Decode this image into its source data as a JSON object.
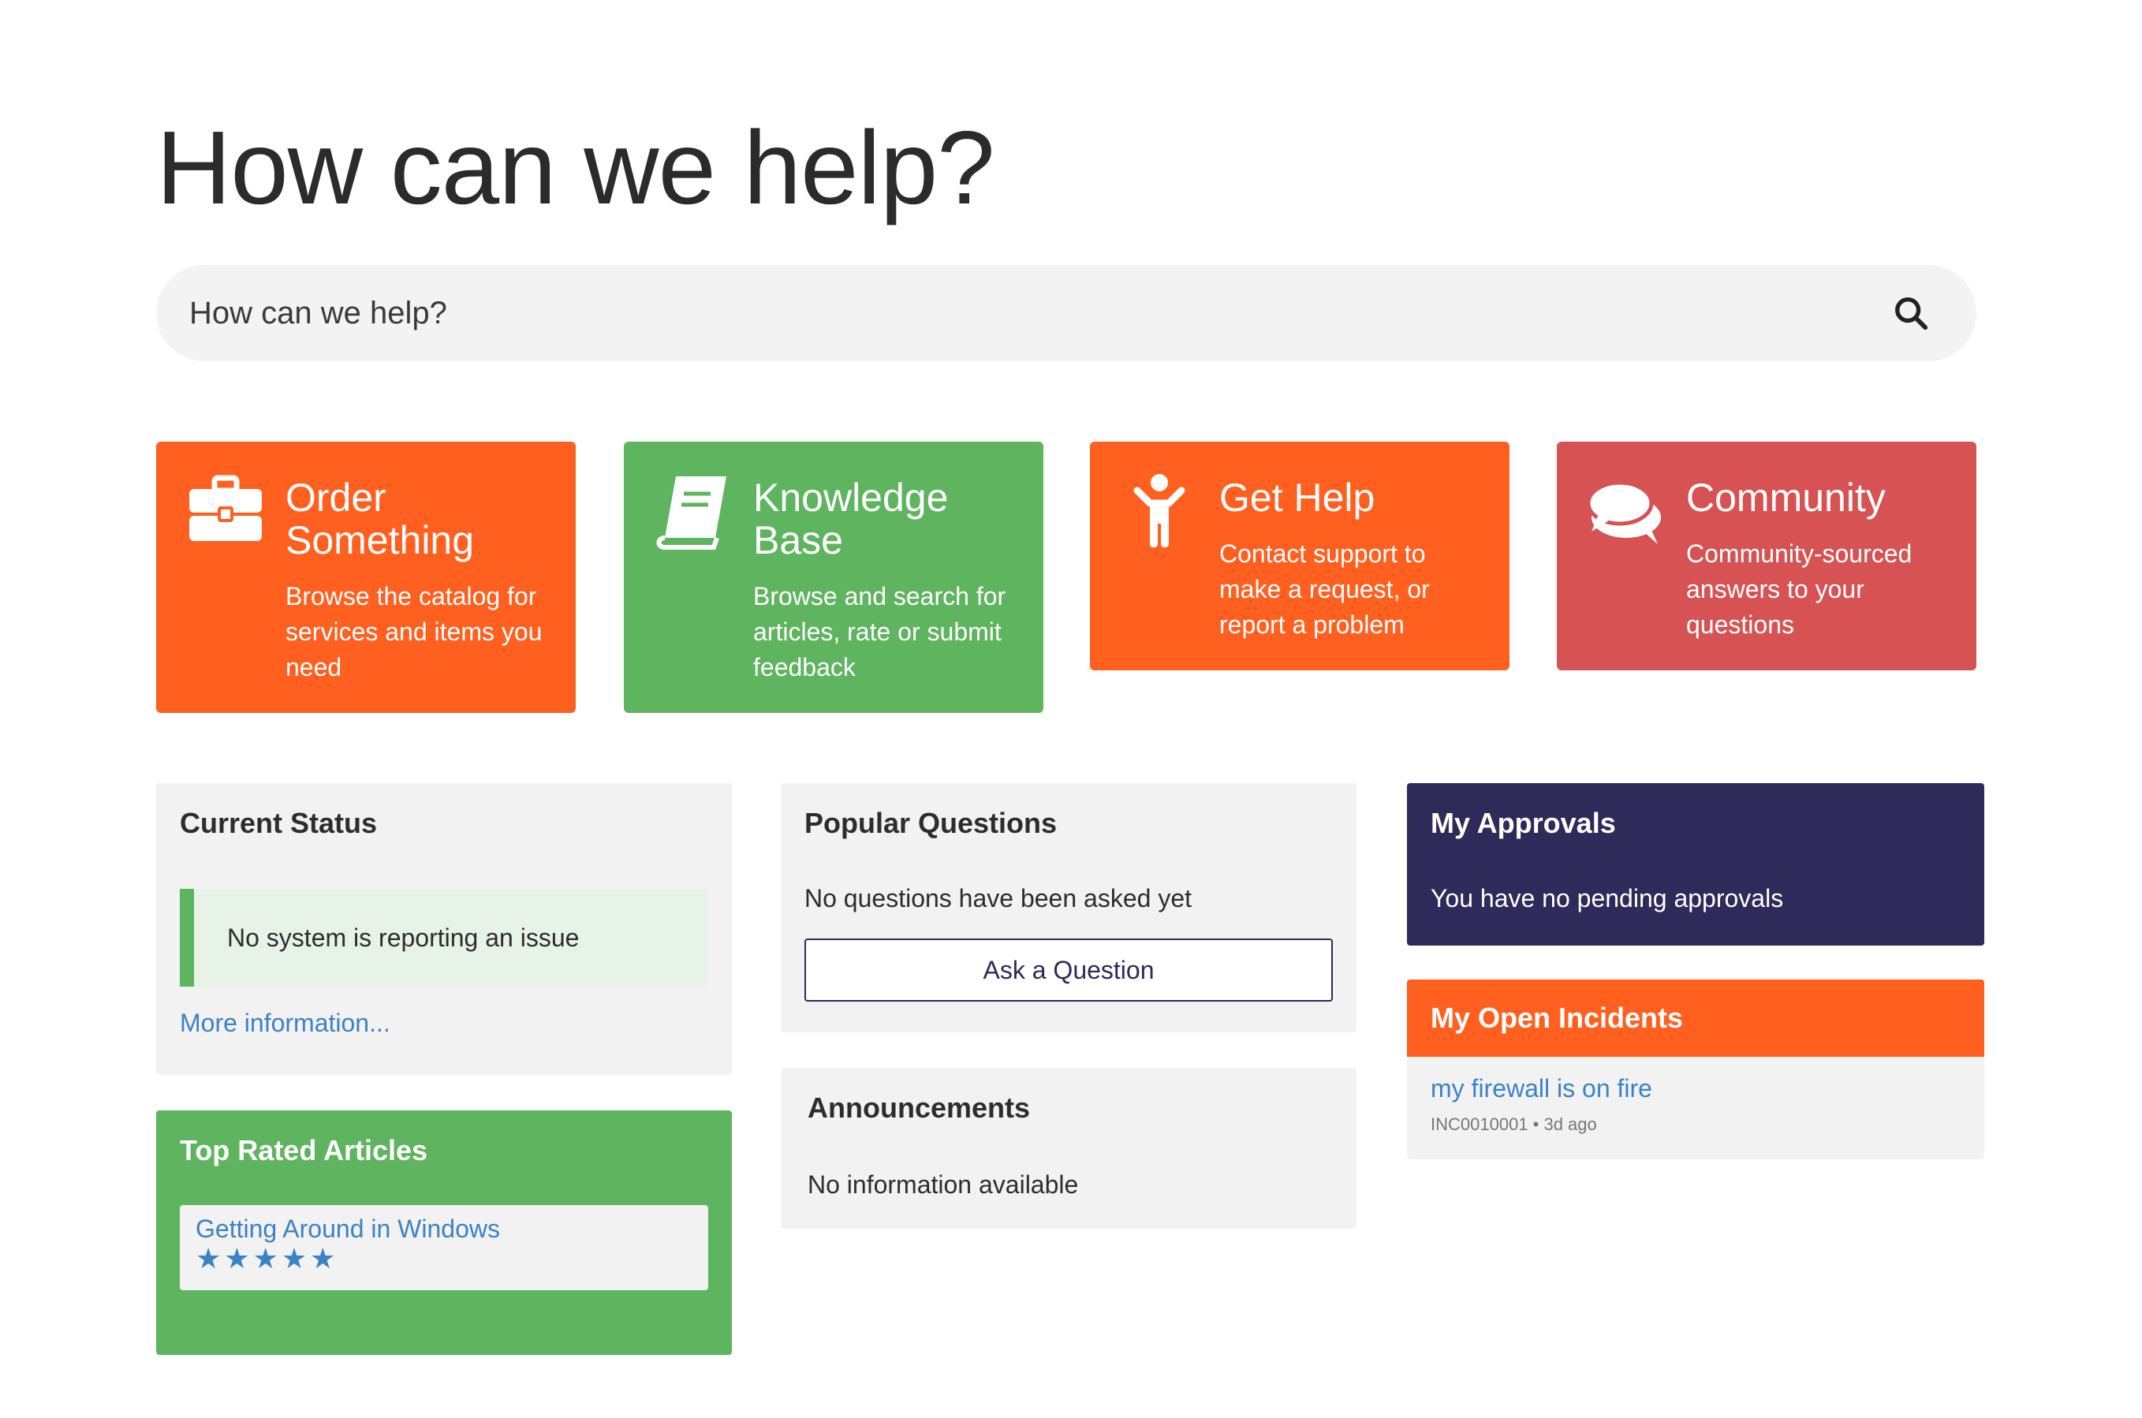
{
  "hero": {
    "title": "How can we help?"
  },
  "search": {
    "placeholder": "How can we help?"
  },
  "tiles": [
    {
      "title": "Order Something",
      "description": "Browse the catalog for services and items you need",
      "icon": "briefcase-icon",
      "color": "#ff5f1f"
    },
    {
      "title": "Knowledge Base",
      "description": "Browse and search for articles, rate or submit feedback",
      "icon": "book-icon",
      "color": "#5fb45f"
    },
    {
      "title": "Get Help",
      "description": "Contact support to make a request, or report a problem",
      "icon": "person-icon",
      "color": "#ff5f1f"
    },
    {
      "title": "Community",
      "description": "Community-sourced answers to your questions",
      "icon": "chat-bubbles-icon",
      "color": "#d75353"
    }
  ],
  "current_status": {
    "title": "Current Status",
    "message": "No system is reporting an issue",
    "link": "More information..."
  },
  "top_rated": {
    "title": "Top Rated Articles",
    "articles": [
      {
        "title": "Getting Around in Windows",
        "stars": "★★★★★",
        "rating": 5
      }
    ]
  },
  "popular_questions": {
    "title": "Popular Questions",
    "message": "No questions have been asked yet",
    "button": "Ask a Question"
  },
  "announcements": {
    "title": "Announcements",
    "message": "No information available"
  },
  "approvals": {
    "title": "My Approvals",
    "message": "You have no pending approvals"
  },
  "incidents": {
    "title": "My Open Incidents",
    "items": [
      {
        "title": "my firewall is on fire",
        "meta": "INC0010001 • 3d ago"
      }
    ]
  },
  "colors": {
    "orange": "#ff5f1f",
    "green": "#5fb45f",
    "red": "#d75353",
    "navy": "#2e2a5a",
    "link": "#3c82c4"
  }
}
